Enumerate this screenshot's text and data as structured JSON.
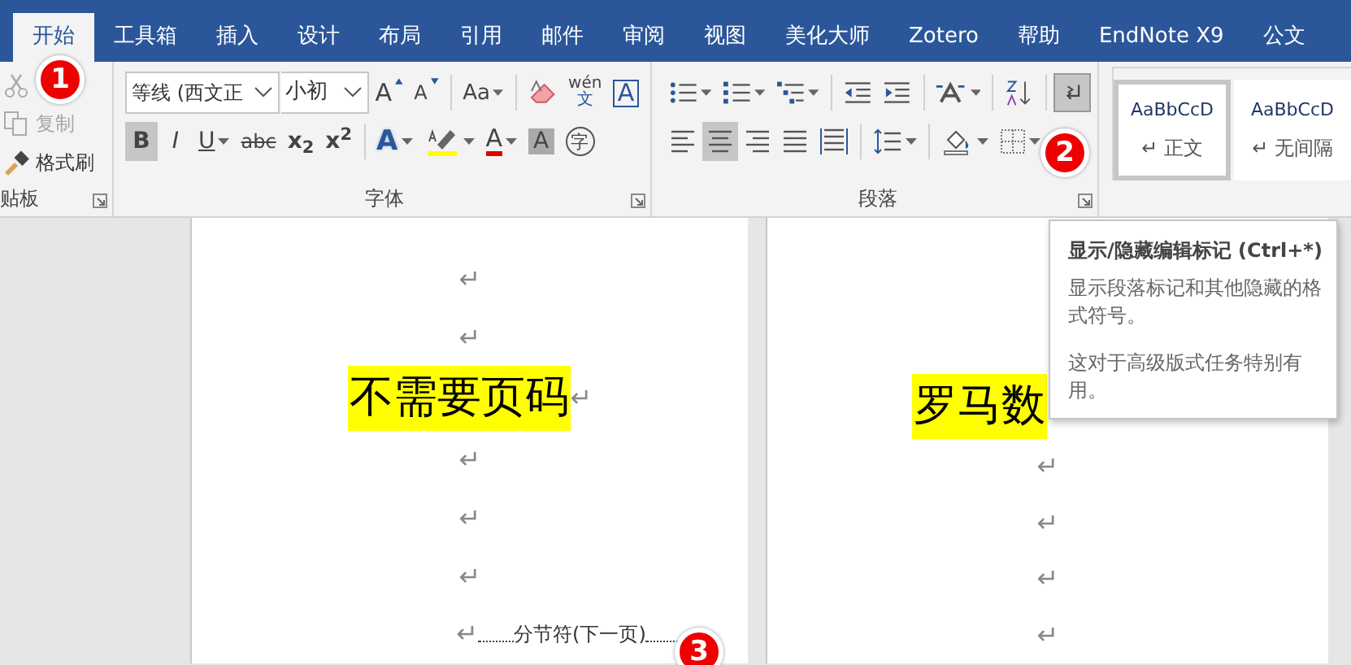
{
  "tabs": [
    {
      "label": "开始",
      "selected": true
    },
    {
      "label": "工具箱",
      "selected": false
    },
    {
      "label": "插入",
      "selected": false
    },
    {
      "label": "设计",
      "selected": false
    },
    {
      "label": "布局",
      "selected": false
    },
    {
      "label": "引用",
      "selected": false
    },
    {
      "label": "邮件",
      "selected": false
    },
    {
      "label": "审阅",
      "selected": false
    },
    {
      "label": "视图",
      "selected": false
    },
    {
      "label": "美化大师",
      "selected": false
    },
    {
      "label": "Zotero",
      "selected": false
    },
    {
      "label": "帮助",
      "selected": false
    },
    {
      "label": "EndNote X9",
      "selected": false
    },
    {
      "label": "公文",
      "selected": false
    }
  ],
  "clipboard": {
    "label": "贴板",
    "items": [
      {
        "kind": "cut",
        "disabled": true
      },
      {
        "kind": "copy",
        "label": "复制",
        "disabled": true
      },
      {
        "kind": "format_painter",
        "label": "格式刷",
        "disabled": false
      }
    ]
  },
  "font": {
    "label": "字体",
    "font_name": "等线 (西文正",
    "font_size": "小初",
    "row1": [
      {
        "kind": "grow",
        "text": "A",
        "selected": false,
        "caret": false
      },
      {
        "kind": "shrink",
        "text": "A",
        "selected": false,
        "caret": false
      },
      {
        "kind": "separator"
      },
      {
        "kind": "case",
        "text": "Aa",
        "selected": false,
        "caret": true
      },
      {
        "kind": "separator"
      },
      {
        "kind": "clear_format",
        "selected": false,
        "caret": false
      },
      {
        "kind": "phonetic",
        "text": "wén",
        "subtext": "文",
        "selected": false,
        "caret": false
      },
      {
        "kind": "char_border",
        "text": "A",
        "selected": false,
        "caret": false
      }
    ],
    "row2": [
      {
        "kind": "bold",
        "text": "B",
        "selected": true,
        "caret": false
      },
      {
        "kind": "italic",
        "text": "I",
        "selected": false,
        "caret": false
      },
      {
        "kind": "underline",
        "text": "U",
        "selected": false,
        "caret": true
      },
      {
        "kind": "strike",
        "text": "abc",
        "selected": false,
        "caret": false
      },
      {
        "kind": "subscript",
        "text": "x$_{2}$",
        "selected": false,
        "caret": false
      },
      {
        "kind": "superscript",
        "text": "x$^{2}$",
        "selected": false,
        "caret": false
      },
      {
        "kind": "separator"
      },
      {
        "kind": "text_effect",
        "text": "A",
        "selected": false,
        "caret": true
      },
      {
        "kind": "highlight",
        "selected": false,
        "caret": true
      },
      {
        "kind": "font_color",
        "text": "A",
        "selected": false,
        "caret": true
      },
      {
        "kind": "char_shading",
        "text": "A",
        "selected": false,
        "caret": false
      },
      {
        "kind": "enclose",
        "text": "字",
        "selected": false,
        "caret": false
      }
    ]
  },
  "paragraph": {
    "label": "段落",
    "row1": [
      {
        "kind": "bullets",
        "selected": false,
        "caret": true
      },
      {
        "kind": "numbering",
        "selected": false,
        "caret": true
      },
      {
        "kind": "multilevel",
        "selected": false,
        "caret": true
      },
      {
        "kind": "separator"
      },
      {
        "kind": "outdent",
        "selected": false,
        "caret": false
      },
      {
        "kind": "indent",
        "selected": false,
        "caret": false
      },
      {
        "kind": "separator"
      },
      {
        "kind": "asian_layout",
        "selected": false,
        "caret": true
      },
      {
        "kind": "separator"
      },
      {
        "kind": "sort",
        "selected": false,
        "caret": false
      },
      {
        "kind": "separator"
      },
      {
        "kind": "show_marks",
        "selected": true,
        "caret": false
      }
    ],
    "row2": [
      {
        "kind": "align_left",
        "selected": false,
        "caret": false
      },
      {
        "kind": "align_center",
        "selected": true,
        "caret": false
      },
      {
        "kind": "align_right",
        "selected": false,
        "caret": false
      },
      {
        "kind": "justify",
        "selected": false,
        "caret": false
      },
      {
        "kind": "distribute",
        "selected": false,
        "caret": false
      },
      {
        "kind": "separator"
      },
      {
        "kind": "line_spacing",
        "selected": false,
        "caret": true
      },
      {
        "kind": "separator"
      },
      {
        "kind": "shading",
        "selected": false,
        "caret": true
      },
      {
        "kind": "borders",
        "selected": false,
        "caret": true
      }
    ]
  },
  "styles": [
    {
      "preview": "AaBbCcD",
      "mark": "↵",
      "label": "正文",
      "selected": true
    },
    {
      "preview": "AaBbCcD",
      "mark": "↵",
      "label": "无间隔",
      "selected": false
    }
  ],
  "pages": [
    {
      "paragraphs": [
        {
          "kind": "empty",
          "mark": "↵"
        },
        {
          "kind": "empty",
          "mark": "↵"
        },
        {
          "kind": "heading",
          "text": "不需要页码",
          "highlight": true,
          "mark": "↵"
        },
        {
          "kind": "empty",
          "mark": "↵"
        },
        {
          "kind": "empty",
          "mark": "↵"
        },
        {
          "kind": "empty",
          "mark": "↵"
        },
        {
          "kind": "section_break",
          "mark": "↵",
          "text": "分节符(下一页)"
        }
      ]
    },
    {
      "paragraphs": [
        {
          "kind": "heading",
          "text": "罗马数",
          "highlight": true
        },
        {
          "kind": "empty",
          "mark": "↵"
        },
        {
          "kind": "empty",
          "mark": "↵"
        },
        {
          "kind": "empty",
          "mark": "↵"
        },
        {
          "kind": "empty",
          "mark": "↵"
        }
      ]
    }
  ],
  "tooltip": {
    "title": "显示/隐藏编辑标记 (Ctrl+*)",
    "body": [
      "显示段落标记和其他隐藏的格式符号。",
      "这对于高级版式任务特别有用。"
    ]
  },
  "callouts": [
    "1",
    "2",
    "3"
  ]
}
